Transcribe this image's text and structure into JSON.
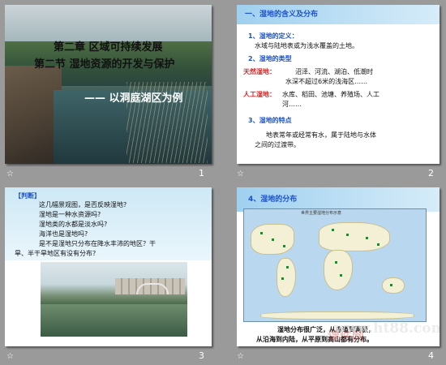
{
  "slides": [
    {
      "number": "1",
      "title_line1": "第二章 区域可持续发展",
      "title_line2": "第二节 湿地资源的开发与保护",
      "subtitle": "—— 以洞庭湖区为例"
    },
    {
      "number": "2",
      "section_heading": "一、湿地的含义及分布",
      "item1_heading": "1、湿地的定义：",
      "item1_text": "水域与陆地表或为浅水覆盖的土地。",
      "item2_heading": "2、湿地的类型",
      "natural_label": "天然湿地：",
      "natural_text_line1": "沼泽、河流、湖泊、低潮时",
      "natural_text_line2": "水深不超过6米的浅海区……",
      "artificial_label": "人工湿地：",
      "artificial_text_line1": "水库、稻田、池塘、养殖场、人工",
      "artificial_text_line2": "河……",
      "item3_heading": "3、湿地的特点",
      "item3_text_line1": "地表常年或经常有水，属于陆地与水体",
      "item3_text_line2": "之间的过渡带。"
    },
    {
      "number": "3",
      "label": "【判断】",
      "lines": [
        "这几幅景观图，是否反映湿地?",
        "湿地是一种水资源吗?",
        "湿地类的水都是淡水吗?",
        "海洋也是湿地吗?",
        "是不是湿地只分布在降水丰沛的地区？干",
        "旱、半干旱地区有没有分布?"
      ]
    },
    {
      "number": "4",
      "heading": "4、湿地的分布",
      "map_title": "世界主要湿地分布示意",
      "caption_line1": "湿地分布很广泛，从赤道到两极，",
      "caption_line2": "从沿海到内陆，从平原到高山都有分布。",
      "watermark": "www.ht88.com",
      "watermark_cn": "课件网"
    }
  ],
  "star_glyph": "☆",
  "colors": {
    "heading_blue": "#1d52c9",
    "label_red": "#e01e1e",
    "wetland_green": "#1d8a2d",
    "header_bar": "#9fd0ef"
  }
}
